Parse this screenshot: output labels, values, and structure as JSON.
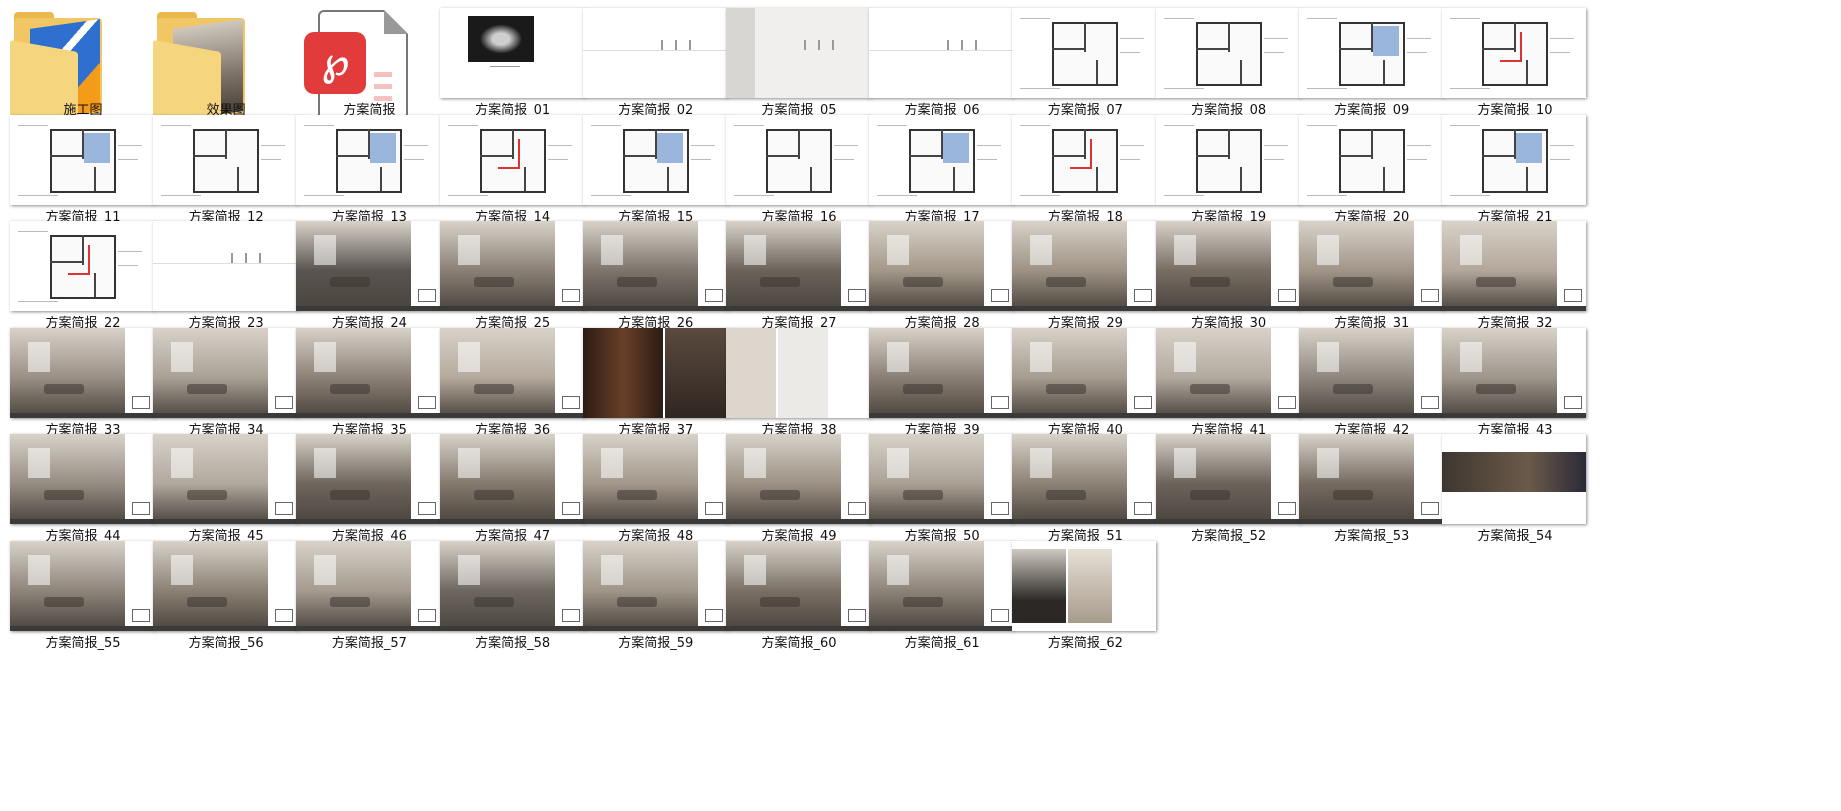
{
  "files": [
    {
      "name": "施工图",
      "type": "folder",
      "preview": "dwg"
    },
    {
      "name": "效果图",
      "type": "folder",
      "preview": "render"
    },
    {
      "name": "方案简报",
      "type": "pdf"
    },
    {
      "name": "方案简报_01",
      "type": "slide",
      "kind": "cover"
    },
    {
      "name": "方案简报_02",
      "type": "slide",
      "kind": "text"
    },
    {
      "name": "方案简报_05",
      "type": "slide",
      "kind": "text-grey"
    },
    {
      "name": "方案简报_06",
      "type": "slide",
      "kind": "text"
    },
    {
      "name": "方案简报_07",
      "type": "slide",
      "kind": "plan"
    },
    {
      "name": "方案简报_08",
      "type": "slide",
      "kind": "plan"
    },
    {
      "name": "方案简报_09",
      "type": "slide",
      "kind": "plan-blue"
    },
    {
      "name": "方案简报_10",
      "type": "slide",
      "kind": "plan-red"
    },
    {
      "name": "方案简报_11",
      "type": "slide",
      "kind": "plan-blue"
    },
    {
      "name": "方案简报_12",
      "type": "slide",
      "kind": "plan"
    },
    {
      "name": "方案简报_13",
      "type": "slide",
      "kind": "plan-blue"
    },
    {
      "name": "方案简报_14",
      "type": "slide",
      "kind": "plan-red"
    },
    {
      "name": "方案简报_15",
      "type": "slide",
      "kind": "plan-blue"
    },
    {
      "name": "方案简报_16",
      "type": "slide",
      "kind": "plan"
    },
    {
      "name": "方案简报_17",
      "type": "slide",
      "kind": "plan-blue"
    },
    {
      "name": "方案简报_18",
      "type": "slide",
      "kind": "plan-red"
    },
    {
      "name": "方案简报_19",
      "type": "slide",
      "kind": "plan"
    },
    {
      "name": "方案简报_20",
      "type": "slide",
      "kind": "plan"
    },
    {
      "name": "方案简报_21",
      "type": "slide",
      "kind": "plan-blue"
    },
    {
      "name": "方案简报_22",
      "type": "slide",
      "kind": "plan-red"
    },
    {
      "name": "方案简报_23",
      "type": "slide",
      "kind": "text"
    },
    {
      "name": "方案简报_24",
      "type": "slide",
      "kind": "render",
      "tone": "#5a5450"
    },
    {
      "name": "方案简报_25",
      "type": "slide",
      "kind": "render",
      "tone": "#8a8076"
    },
    {
      "name": "方案简报_26",
      "type": "slide",
      "kind": "render",
      "tone": "#7d746c"
    },
    {
      "name": "方案简报_27",
      "type": "slide",
      "kind": "render",
      "tone": "#6b625a"
    },
    {
      "name": "方案简报_28",
      "type": "slide",
      "kind": "render",
      "tone": "#a39889"
    },
    {
      "name": "方案简报_29",
      "type": "slide",
      "kind": "render",
      "tone": "#9d9284"
    },
    {
      "name": "方案简报_30",
      "type": "slide",
      "kind": "render",
      "tone": "#776d63"
    },
    {
      "name": "方案简报_31",
      "type": "slide",
      "kind": "render",
      "tone": "#a09588"
    },
    {
      "name": "方案简报_32",
      "type": "slide",
      "kind": "render",
      "tone": "#b2a79a"
    },
    {
      "name": "方案简报_33",
      "type": "slide",
      "kind": "render",
      "tone": "#9a9085"
    },
    {
      "name": "方案简报_34",
      "type": "slide",
      "kind": "render",
      "tone": "#aaa196"
    },
    {
      "name": "方案简报_35",
      "type": "slide",
      "kind": "render",
      "tone": "#8c8176"
    },
    {
      "name": "方案简报_36",
      "type": "slide",
      "kind": "render",
      "tone": "#b5aa9d"
    },
    {
      "name": "方案简报_37",
      "type": "slide",
      "kind": "render-dark",
      "tone": "#3e2c22"
    },
    {
      "name": "方案简报_38",
      "type": "slide",
      "kind": "render-light",
      "tone": "#d9d4cd"
    },
    {
      "name": "方案简报_39",
      "type": "slide",
      "kind": "render",
      "tone": "#8a7f74"
    },
    {
      "name": "方案简报_40",
      "type": "slide",
      "kind": "render",
      "tone": "#a69c90"
    },
    {
      "name": "方案简报_41",
      "type": "slide",
      "kind": "render",
      "tone": "#b3aa9f"
    },
    {
      "name": "方案简报_42",
      "type": "slide",
      "kind": "render",
      "tone": "#8f877e"
    },
    {
      "name": "方案简报_43",
      "type": "slide",
      "kind": "render",
      "tone": "#9e958b"
    },
    {
      "name": "方案简报_44",
      "type": "slide",
      "kind": "render",
      "tone": "#968d83"
    },
    {
      "name": "方案简报_45",
      "type": "slide",
      "kind": "render",
      "tone": "#b1a89e"
    },
    {
      "name": "方案简报_46",
      "type": "slide",
      "kind": "render",
      "tone": "#6f665d"
    },
    {
      "name": "方案简报_47",
      "type": "slide",
      "kind": "render",
      "tone": "#84796d"
    },
    {
      "name": "方案简报_48",
      "type": "slide",
      "kind": "render",
      "tone": "#a2978a"
    },
    {
      "name": "方案简报_49",
      "type": "slide",
      "kind": "render",
      "tone": "#9c9184"
    },
    {
      "name": "方案简报_50",
      "type": "slide",
      "kind": "render",
      "tone": "#aaa195"
    },
    {
      "name": "方案简报_51",
      "type": "slide",
      "kind": "render",
      "tone": "#8d8276"
    },
    {
      "name": "方案简报_52",
      "type": "slide",
      "kind": "render",
      "tone": "#6c635b"
    },
    {
      "name": "方案简报_53",
      "type": "slide",
      "kind": "render",
      "tone": "#756b61"
    },
    {
      "name": "方案简报_54",
      "type": "slide",
      "kind": "render-band",
      "tone": "#4d4640"
    },
    {
      "name": "方案简报_55",
      "type": "slide",
      "kind": "render",
      "tone": "#8e857b"
    },
    {
      "name": "方案简报_56",
      "type": "slide",
      "kind": "render",
      "tone": "#8b8174"
    },
    {
      "name": "方案简报_57",
      "type": "slide",
      "kind": "render",
      "tone": "#a59b8f"
    },
    {
      "name": "方案简报_58",
      "type": "slide",
      "kind": "render",
      "tone": "#6e6760"
    },
    {
      "name": "方案简报_59",
      "type": "slide",
      "kind": "render",
      "tone": "#9f9588"
    },
    {
      "name": "方案简报_60",
      "type": "slide",
      "kind": "render",
      "tone": "#7a7065"
    },
    {
      "name": "方案简报_61",
      "type": "slide",
      "kind": "render",
      "tone": "#8d8479"
    },
    {
      "name": "方案简报_62",
      "type": "slide",
      "kind": "render-split",
      "tone": "#8a8178"
    }
  ]
}
